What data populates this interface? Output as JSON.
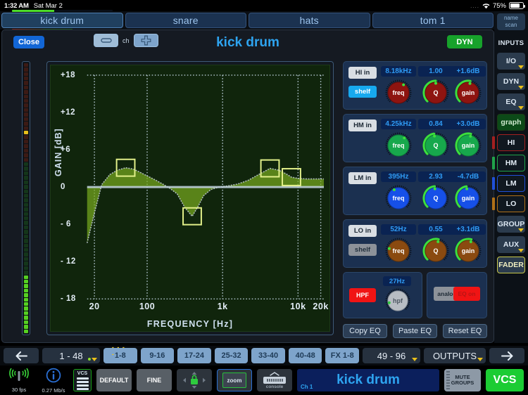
{
  "status_bar": {
    "time": "1:32 AM",
    "date": "Sat Mar 2",
    "dots": "....",
    "battery_percent": "75%",
    "wifi_icon": "wifi-icon",
    "battery_icon": "battery-icon"
  },
  "channel_tabs": {
    "items": [
      {
        "label": "kick drum",
        "selected": true
      },
      {
        "label": "snare",
        "selected": false
      },
      {
        "label": "hats",
        "selected": false
      },
      {
        "label": "tom 1",
        "selected": false
      }
    ],
    "name_scan": {
      "line1": "name",
      "line2": "scan"
    }
  },
  "panel": {
    "close_label": "Close",
    "ch_label": "ch",
    "minus_icon": "minus-icon",
    "plus_icon": "plus-icon",
    "title": "kick drum",
    "dyn_label": "DYN"
  },
  "chart_data": {
    "type": "line",
    "title": "",
    "xlabel": "FREQUENCY [Hz]",
    "ylabel": "GAIN [dB]",
    "xticks": [
      "20",
      "100",
      "1k",
      "10k",
      "20k"
    ],
    "yticks": [
      "+18",
      "+12",
      "+6",
      "0",
      "- 6",
      "- 12",
      "- 18"
    ],
    "ylim": [
      -18,
      18
    ],
    "xlim_hz": [
      16,
      22000
    ],
    "grid": true,
    "curve_color": "#b9c4ce",
    "fill_color": "#76a81e",
    "zero_line_color": "#c3d3e2",
    "handle_color": "#e2f08a",
    "handles": [
      {
        "band": "LO",
        "freq_hz": 52,
        "gain_db": 3.1
      },
      {
        "band": "LM",
        "freq_hz": 395,
        "gain_db": -4.7
      },
      {
        "band": "HM",
        "freq_hz": 4250,
        "gain_db": 3.0
      },
      {
        "band": "HI",
        "freq_hz": 8180,
        "gain_db": 1.6
      }
    ],
    "points": [
      {
        "f": 16,
        "g": -9.0
      },
      {
        "f": 20,
        "g": -4.2
      },
      {
        "f": 25,
        "g": 0.4
      },
      {
        "f": 32,
        "g": 2.0
      },
      {
        "f": 40,
        "g": 2.7
      },
      {
        "f": 52,
        "g": 3.1
      },
      {
        "f": 65,
        "g": 2.9
      },
      {
        "f": 80,
        "g": 2.4
      },
      {
        "f": 100,
        "g": 1.8
      },
      {
        "f": 130,
        "g": 1.1
      },
      {
        "f": 160,
        "g": 0.5
      },
      {
        "f": 200,
        "g": -0.2
      },
      {
        "f": 250,
        "g": -1.1
      },
      {
        "f": 320,
        "g": -3.4
      },
      {
        "f": 395,
        "g": -4.7
      },
      {
        "f": 470,
        "g": -3.2
      },
      {
        "f": 560,
        "g": -1.4
      },
      {
        "f": 700,
        "g": -0.4
      },
      {
        "f": 900,
        "g": 0.0
      },
      {
        "f": 1200,
        "g": 0.2
      },
      {
        "f": 1600,
        "g": 0.5
      },
      {
        "f": 2200,
        "g": 1.1
      },
      {
        "f": 3000,
        "g": 2.0
      },
      {
        "f": 4250,
        "g": 3.0
      },
      {
        "f": 5600,
        "g": 2.7
      },
      {
        "f": 7000,
        "g": 2.1
      },
      {
        "f": 8180,
        "g": 1.6
      },
      {
        "f": 10000,
        "g": 1.4
      },
      {
        "f": 13000,
        "g": 1.3
      },
      {
        "f": 16000,
        "g": 1.3
      },
      {
        "f": 22000,
        "g": 1.3
      }
    ]
  },
  "meter": {
    "name": "channel-input-meter",
    "segments": 60,
    "green_level": 13,
    "peak_segment": 44,
    "colors": {
      "green": "#55d121",
      "dim_green": "#14361a",
      "dim_red": "#3c1a14",
      "peak": "#e9c01a"
    }
  },
  "eq_bands": [
    {
      "id": "hi",
      "tag": "HI in",
      "shelf": {
        "label": "shelf",
        "active": true
      },
      "freq": {
        "label": "freq",
        "value": "8.18kHz",
        "angle_pct": 0.62
      },
      "q": {
        "label": "Q",
        "value": "1.00",
        "angle_pct": 0.5
      },
      "gain": {
        "label": "gain",
        "value": "+1.6dB",
        "angle_pct": 0.54
      },
      "knob_color": "#8e1410",
      "knob_color_dark": "#5e0c0a",
      "arc_color": "#3ce03c",
      "active": false
    },
    {
      "id": "hm",
      "tag": "HM in",
      "shelf": null,
      "freq": {
        "label": "freq",
        "value": "4.25kHz",
        "angle_pct": 0.64
      },
      "q": {
        "label": "Q",
        "value": "0.84",
        "angle_pct": 0.47
      },
      "gain": {
        "label": "gain",
        "value": "+3.0dB",
        "angle_pct": 0.55
      },
      "knob_color": "#17a84c",
      "knob_color_dark": "#0e7235",
      "arc_color": "#3ce03c",
      "active": true
    },
    {
      "id": "lm",
      "tag": "LM in",
      "shelf": null,
      "freq": {
        "label": "freq",
        "value": "395Hz",
        "angle_pct": 0.4
      },
      "q": {
        "label": "Q",
        "value": "2.93",
        "angle_pct": 0.48
      },
      "gain": {
        "label": "gain",
        "value": "-4.7dB",
        "angle_pct": 0.47
      },
      "knob_color": "#1650e8",
      "knob_color_dark": "#0f36a0",
      "arc_color": "#3ce03c",
      "active": true
    },
    {
      "id": "lo",
      "tag": "LO in",
      "shelf": {
        "label": "shelf",
        "active": false
      },
      "freq": {
        "label": "freq",
        "value": "52Hz",
        "angle_pct": 0.22
      },
      "q": {
        "label": "Q",
        "value": "0.55",
        "angle_pct": 0.55
      },
      "gain": {
        "label": "gain",
        "value": "+3.1dB",
        "angle_pct": 0.56
      },
      "knob_color": "#8a4a10",
      "knob_color_dark": "#5c310a",
      "arc_color": "#3ce03c",
      "active": true
    }
  ],
  "filters": {
    "hpf": {
      "button_label": "HPF",
      "value": "27Hz",
      "knob_label": "hpf",
      "angle_pct": 0.12
    },
    "analog_label": "analog",
    "eq_on_label": "EQ on"
  },
  "eq_actions": [
    {
      "label": "Copy EQ"
    },
    {
      "label": "Paste EQ"
    },
    {
      "label": "Reset EQ"
    }
  ],
  "sidebar": {
    "name_scan": {
      "line1": "name",
      "line2": "scan"
    },
    "inputs_header": "INPUTS",
    "items": [
      {
        "label": "I/O",
        "type": "nav",
        "caret": true
      },
      {
        "label": "DYN",
        "type": "nav",
        "caret": true
      },
      {
        "label": "EQ",
        "type": "nav",
        "caret": true
      },
      {
        "label": "graph",
        "type": "graph",
        "caret": false
      },
      {
        "label": "HI",
        "type": "band",
        "color": "#a32020",
        "caret": false
      },
      {
        "label": "HM",
        "type": "band",
        "color": "#20a34a",
        "caret": false
      },
      {
        "label": "LM",
        "type": "band",
        "color": "#2050d8",
        "caret": false
      },
      {
        "label": "LO",
        "type": "band",
        "color": "#b07018",
        "caret": false
      },
      {
        "label": "GROUP",
        "type": "nav",
        "caret": true
      },
      {
        "label": "AUX",
        "type": "nav",
        "caret": true
      },
      {
        "label": "FADER",
        "type": "fader",
        "caret": false
      }
    ]
  },
  "navbar": {
    "back_icon": "arrow-left-icon",
    "forward_icon": "arrow-right-icon",
    "range_left": "1 - 48",
    "range_right": "49 - 96",
    "outputs_label": "OUTPUTS",
    "banks": [
      {
        "label": "1-8",
        "marked": true
      },
      {
        "label": "9-16",
        "marked": false
      },
      {
        "label": "17-24",
        "marked": false
      },
      {
        "label": "25-32",
        "marked": false
      },
      {
        "label": "33-40",
        "marked": false
      },
      {
        "label": "40-48",
        "marked": false
      },
      {
        "label": "FX 1-8",
        "marked": false
      }
    ],
    "bank_dash": "- - - -"
  },
  "toolbar": {
    "fps": "30 fps",
    "bitrate": "0.27 Mb/s",
    "signal_icon": "antenna-icon",
    "info_icon": "info-icon",
    "vcs_icon_label": "VCS",
    "default_label": "DEFAULT",
    "fine_label": "FINE",
    "pan_icon": "pan-lock-icon",
    "zoom_label": "zoom",
    "console_label": "console",
    "channel_number": "Ch 1",
    "channel_name": "kick drum",
    "mute_groups": {
      "line1": "MUTE",
      "line2": "GROUPS"
    },
    "vcs_label": "VCS"
  }
}
